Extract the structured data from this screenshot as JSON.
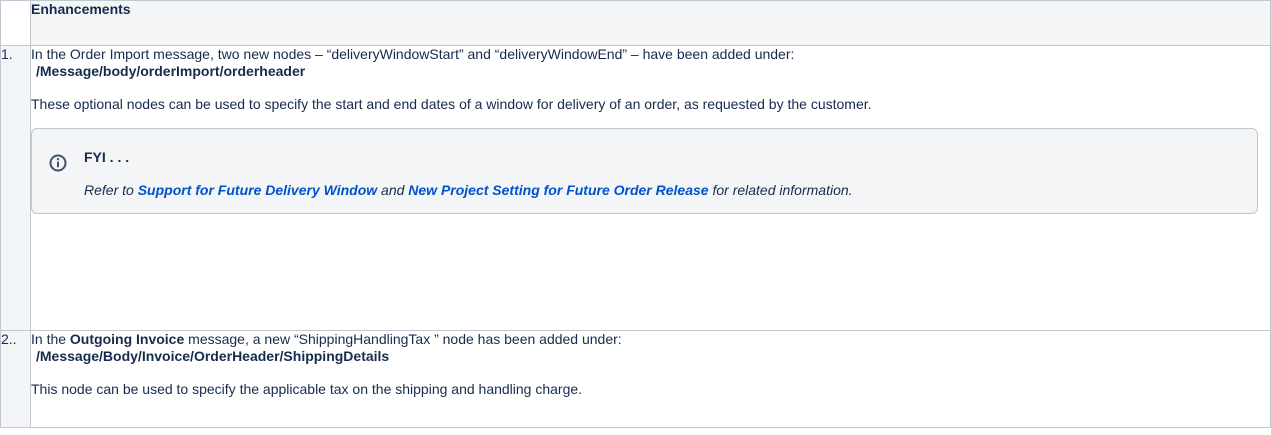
{
  "table": {
    "heading": "Enhancements",
    "rows": [
      {
        "number": "1.",
        "intro": "In the Order Import message, two new nodes – “deliveryWindowStart” and “deliveryWindowEnd” – have been added under:",
        "path": "/Message/body/orderImport/orderheader",
        "paragraph": "These optional nodes can be used to specify the start and end dates of a window for delivery of an order, as requested by the customer.",
        "panel": {
          "icon": "info-icon",
          "title": "FYI . . .",
          "text_before": "Refer to ",
          "link1": "Support for Future Delivery Window",
          "text_middle": " and ",
          "link2": "New Project Setting for Future Order Release",
          "text_after": " for related information."
        }
      },
      {
        "number": "2..",
        "intro_before": "In the ",
        "intro_bold": "Outgoing Invoice",
        "intro_after": " message, a new “ShippingHandlingTax ” node has been added under:",
        "path": "/Message/Body/Invoice/OrderHeader/ShippingDetails",
        "paragraph": "This node can be used to specify the applicable tax on the shipping and handling charge."
      }
    ]
  },
  "colors": {
    "header_bg": "#f4f5f7",
    "border": "#c1c7d0",
    "link": "#0052cc",
    "text": "#172b4d"
  }
}
